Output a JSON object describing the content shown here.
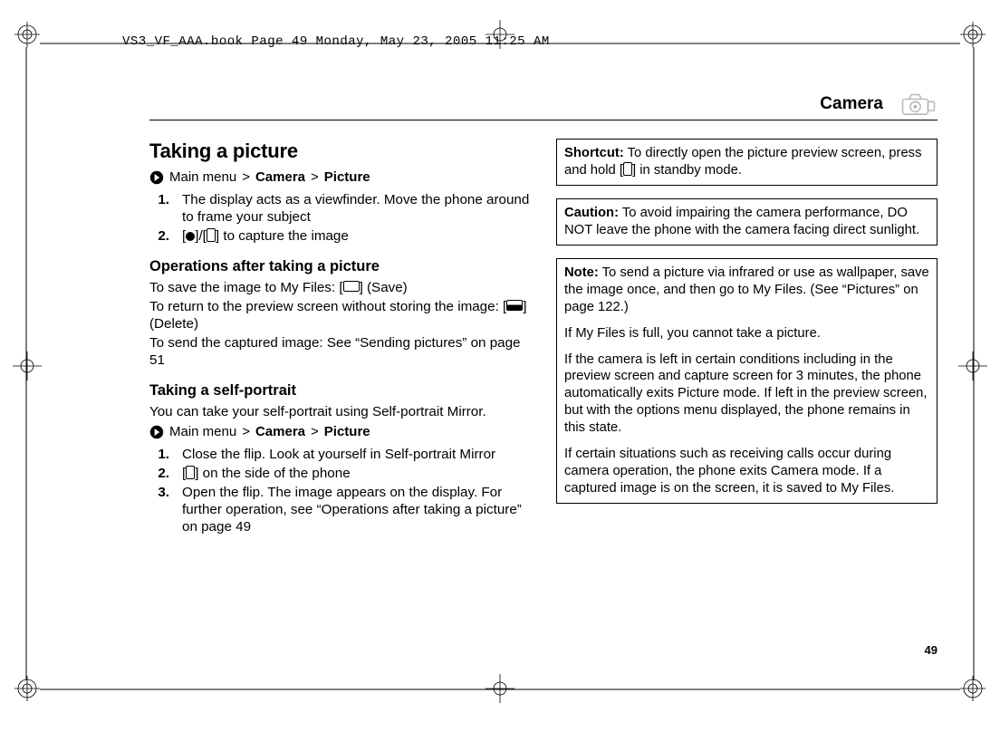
{
  "running_head": "VS3_VF_AAA.book  Page 49  Monday, May 23, 2005  11:25 AM",
  "page_number": "49",
  "header": {
    "title": "Camera"
  },
  "left": {
    "h2": "Taking a picture",
    "bc1": {
      "root": "Main menu",
      "gt1": ">",
      "a": "Camera",
      "gt2": ">",
      "b": "Picture"
    },
    "steps1": [
      {
        "n": "1.",
        "t": "The display acts as a viewfinder. Move the phone around to frame your subject"
      },
      {
        "n": "2.",
        "pre": "[",
        "mid": "]/[",
        "post": "] to capture the image"
      }
    ],
    "h3a": "Operations after taking a picture",
    "op1a": "To save the image to My Files: [",
    "op1b": "] (Save)",
    "op2a": "To return to the preview screen without storing the image: [",
    "op2b": "] (Delete)",
    "op3": "To send the captured image: See “Sending pictures” on page 51",
    "h3b": "Taking a self-portrait",
    "sp_intro": "You can take your self-portrait using Self-portrait Mirror.",
    "bc2": {
      "root": "Main menu",
      "gt1": ">",
      "a": "Camera",
      "gt2": ">",
      "b": "Picture"
    },
    "steps2": [
      {
        "n": "1.",
        "t": "Close the flip. Look at yourself in Self-portrait Mirror"
      },
      {
        "n": "2.",
        "pre": "[",
        "post": "] on the side of the phone"
      },
      {
        "n": "3.",
        "t": "Open the flip. The image appears on the display. For further operation, see “Operations after taking a picture” on page 49"
      }
    ]
  },
  "right": {
    "shortcut_label": "Shortcut:",
    "shortcut_a": "  To directly open the picture preview screen, press and hold [",
    "shortcut_b": "] in standby mode.",
    "caution_label": "Caution:",
    "caution_t": "  To avoid impairing the camera performance, DO NOT leave the phone with the camera facing direct sunlight.",
    "note_label": "Note:",
    "note_p1": "  To send a picture via infrared or use as wallpaper, save the image once, and then go to My Files. (See “Pictures” on page 122.)",
    "note_p2": "If My Files is full, you cannot take a picture.",
    "note_p3": "If the camera is left in certain conditions including in the preview screen and capture screen for 3 minutes, the phone automatically exits Picture mode. If left in the preview screen, but with the options menu displayed, the phone remains in this state.",
    "note_p4": "If certain situations such as receiving calls occur during camera operation, the phone exits Camera mode. If a captured image is on the screen, it is saved to My Files."
  }
}
